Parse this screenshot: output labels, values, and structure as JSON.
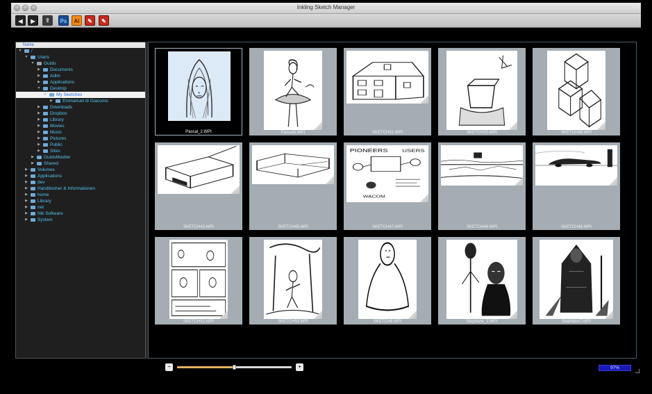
{
  "window": {
    "title": "Inkling Sketch Manager"
  },
  "toolbar": {
    "back_label": "◀",
    "forward_label": "▶",
    "share_label": "⇪",
    "photoshop_label": "Ps",
    "illustrator_label": "Ai",
    "tool_red1_label": "✎",
    "tool_red2_label": "✎"
  },
  "sidebar": {
    "header": "Name",
    "tree": [
      {
        "label": "/",
        "depth": 0,
        "expanded": true,
        "icon": "disk-icon"
      },
      {
        "label": "Users",
        "depth": 1,
        "expanded": true,
        "icon": "folder-icon"
      },
      {
        "label": "Guido",
        "depth": 2,
        "expanded": true,
        "icon": "home-folder-icon"
      },
      {
        "label": "Documents",
        "depth": 3,
        "expanded": false,
        "icon": "folder-icon"
      },
      {
        "label": "Adlm",
        "depth": 3,
        "expanded": false,
        "icon": "folder-icon"
      },
      {
        "label": "Applications",
        "depth": 3,
        "expanded": false,
        "icon": "folder-icon"
      },
      {
        "label": "Desktop",
        "depth": 3,
        "expanded": true,
        "icon": "folder-icon"
      },
      {
        "label": "My Sketches",
        "depth": 4,
        "expanded": true,
        "icon": "folder-icon",
        "selected": true
      },
      {
        "label": "Emmanuel di Giacomo",
        "depth": 5,
        "expanded": false,
        "icon": "folder-icon"
      },
      {
        "label": "Downloads",
        "depth": 3,
        "expanded": false,
        "icon": "folder-icon"
      },
      {
        "label": "Dropbox",
        "depth": 3,
        "expanded": false,
        "icon": "folder-icon"
      },
      {
        "label": "Library",
        "depth": 3,
        "expanded": false,
        "icon": "folder-icon"
      },
      {
        "label": "Movies",
        "depth": 3,
        "expanded": false,
        "icon": "folder-icon"
      },
      {
        "label": "Music",
        "depth": 3,
        "expanded": false,
        "icon": "folder-icon"
      },
      {
        "label": "Pictures",
        "depth": 3,
        "expanded": false,
        "icon": "folder-icon"
      },
      {
        "label": "Public",
        "depth": 3,
        "expanded": false,
        "icon": "folder-icon"
      },
      {
        "label": "Sites",
        "depth": 3,
        "expanded": false,
        "icon": "folder-icon"
      },
      {
        "label": "GuidoMoeller",
        "depth": 2,
        "expanded": false,
        "icon": "folder-icon"
      },
      {
        "label": "Shared",
        "depth": 2,
        "expanded": false,
        "icon": "folder-icon"
      },
      {
        "label": "Volumes",
        "depth": 1,
        "expanded": false,
        "icon": "folder-icon"
      },
      {
        "label": "Applications",
        "depth": 1,
        "expanded": false,
        "icon": "folder-icon"
      },
      {
        "label": "dev",
        "depth": 1,
        "expanded": false,
        "icon": "folder-icon"
      },
      {
        "label": "Handbücher & Informationen",
        "depth": 1,
        "expanded": false,
        "icon": "folder-icon"
      },
      {
        "label": "home",
        "depth": 1,
        "expanded": false,
        "icon": "folder-icon"
      },
      {
        "label": "Library",
        "depth": 1,
        "expanded": false,
        "icon": "folder-icon"
      },
      {
        "label": "net",
        "depth": 1,
        "expanded": false,
        "icon": "folder-icon"
      },
      {
        "label": "Nik Software",
        "depth": 1,
        "expanded": false,
        "icon": "folder-icon"
      },
      {
        "label": "System",
        "depth": 1,
        "expanded": false,
        "icon": "folder-icon"
      }
    ]
  },
  "thumbnails": [
    {
      "name": "Pascal_2.WPI",
      "selected": true,
      "subject": "hooded-portrait"
    },
    {
      "name": "Pascal5.WPI",
      "selected": false,
      "subject": "figure-on-mushroom"
    },
    {
      "name": "SKETCH31.WPI",
      "selected": false,
      "subject": "house"
    },
    {
      "name": "SKETCH33.WPI",
      "selected": false,
      "subject": "chair"
    },
    {
      "name": "SKETCH38.WPI",
      "selected": false,
      "subject": "cube-structure"
    },
    {
      "name": "SKETCH43.WPI",
      "selected": false,
      "subject": "box-device"
    },
    {
      "name": "SKETCH45.WPI",
      "selected": false,
      "subject": "sofa"
    },
    {
      "name": "SKETCH47.WPI",
      "selected": false,
      "subject": "pioneers-notes"
    },
    {
      "name": "SKETCH48.WPI",
      "selected": false,
      "subject": "landscape"
    },
    {
      "name": "SKETCH49.WPI",
      "selected": false,
      "subject": "car-scene"
    },
    {
      "name": "SKETCH52.WPI",
      "selected": false,
      "subject": "comic-page"
    },
    {
      "name": "SKETCH53.WPI",
      "selected": false,
      "subject": "forest-figure"
    },
    {
      "name": "SKETCH8.WPI",
      "selected": false,
      "subject": "robed-figure"
    },
    {
      "name": "Stephane_2.WPI",
      "selected": false,
      "subject": "skull-figures"
    },
    {
      "name": "Stephane7.WPI",
      "selected": false,
      "subject": "warrior"
    }
  ],
  "sketch_text": {
    "pioneers_heading": "PIONEERS",
    "users_heading": "USERS",
    "wacom_label": "WACOM"
  },
  "zoom": {
    "value": 0.5,
    "minus_label": "−",
    "plus_label": "+"
  },
  "progress": {
    "label": "97%",
    "value": 97
  }
}
